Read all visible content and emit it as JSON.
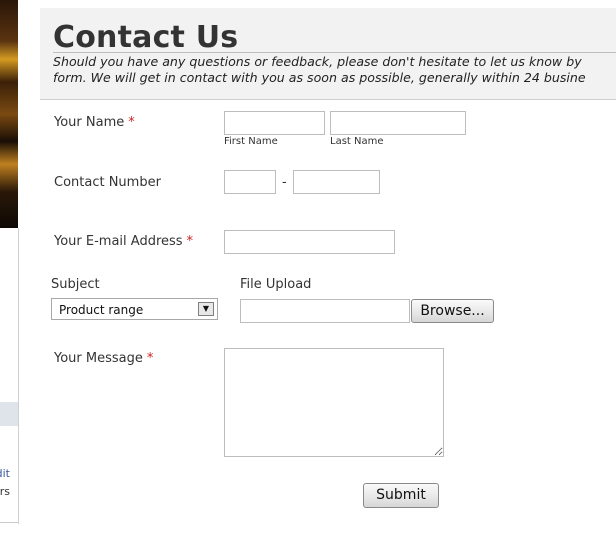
{
  "sidebar": {
    "fragment_1": "dit",
    "fragment_2": "rs"
  },
  "header": {
    "title": "Contact Us",
    "intro_line1": "Should you have any questions or feedback, please don't hesitate to let us know by",
    "intro_line2": "form. We will get in contact with you as soon as possible, generally within 24 busine"
  },
  "form": {
    "required_marker": "*",
    "name": {
      "label": "Your Name",
      "first_label": "First Name",
      "last_label": "Last Name",
      "first_value": "",
      "last_value": ""
    },
    "contact": {
      "label": "Contact Number",
      "separator": "-",
      "area_value": "",
      "number_value": ""
    },
    "email": {
      "label": "Your E-mail Address",
      "value": ""
    },
    "subject": {
      "label": "Subject",
      "selected": "Product range"
    },
    "upload": {
      "label": "File Upload",
      "value": "",
      "browse_label": "Browse..."
    },
    "message": {
      "label": "Your Message",
      "value": ""
    },
    "submit_label": "Submit"
  },
  "colors": {
    "required": "#cc2222",
    "header_bg": "#f2f2f2"
  }
}
